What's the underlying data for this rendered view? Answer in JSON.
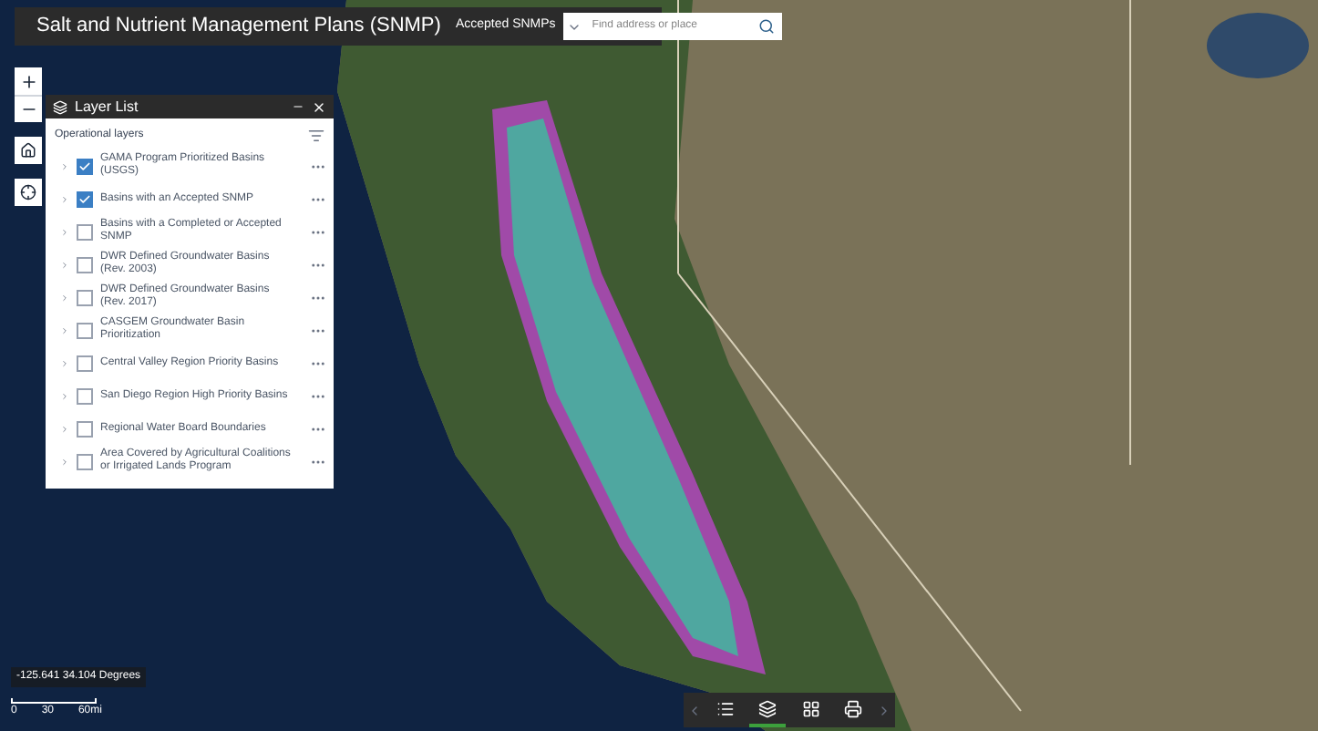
{
  "header": {
    "title": "Salt and Nutrient Management Plans (SNMP)",
    "layer_selector": "Accepted SNMPs",
    "search": {
      "placeholder": "Find address or place"
    }
  },
  "layer_list": {
    "title": "Layer List",
    "section": "Operational layers",
    "layers": [
      {
        "label": "GAMA Program Prioritized Basins (USGS)",
        "checked": true
      },
      {
        "label": "Basins with an Accepted SNMP",
        "checked": true
      },
      {
        "label": "Basins with a Completed or Accepted SNMP",
        "checked": false
      },
      {
        "label": "DWR Defined Groundwater Basins (Rev. 2003)",
        "checked": false
      },
      {
        "label": "DWR Defined Groundwater Basins (Rev. 2017)",
        "checked": false
      },
      {
        "label": "CASGEM Groundwater Basin Prioritization",
        "checked": false
      },
      {
        "label": "Central Valley Region Priority Basins",
        "checked": false
      },
      {
        "label": "San Diego Region High Priority Basins",
        "checked": false
      },
      {
        "label": "Regional Water Board Boundaries",
        "checked": false
      },
      {
        "label": "Area Covered by Agricultural Coalitions or Irrigated Lands Program",
        "checked": false
      }
    ]
  },
  "coordinates": "-125.641 34.104 Degrees",
  "scale_bar": [
    "0",
    "30",
    "60mi"
  ],
  "toolbar": [
    {
      "selected": false
    },
    {
      "selected": true
    },
    {
      "selected": false
    },
    {
      "selected": false
    }
  ]
}
